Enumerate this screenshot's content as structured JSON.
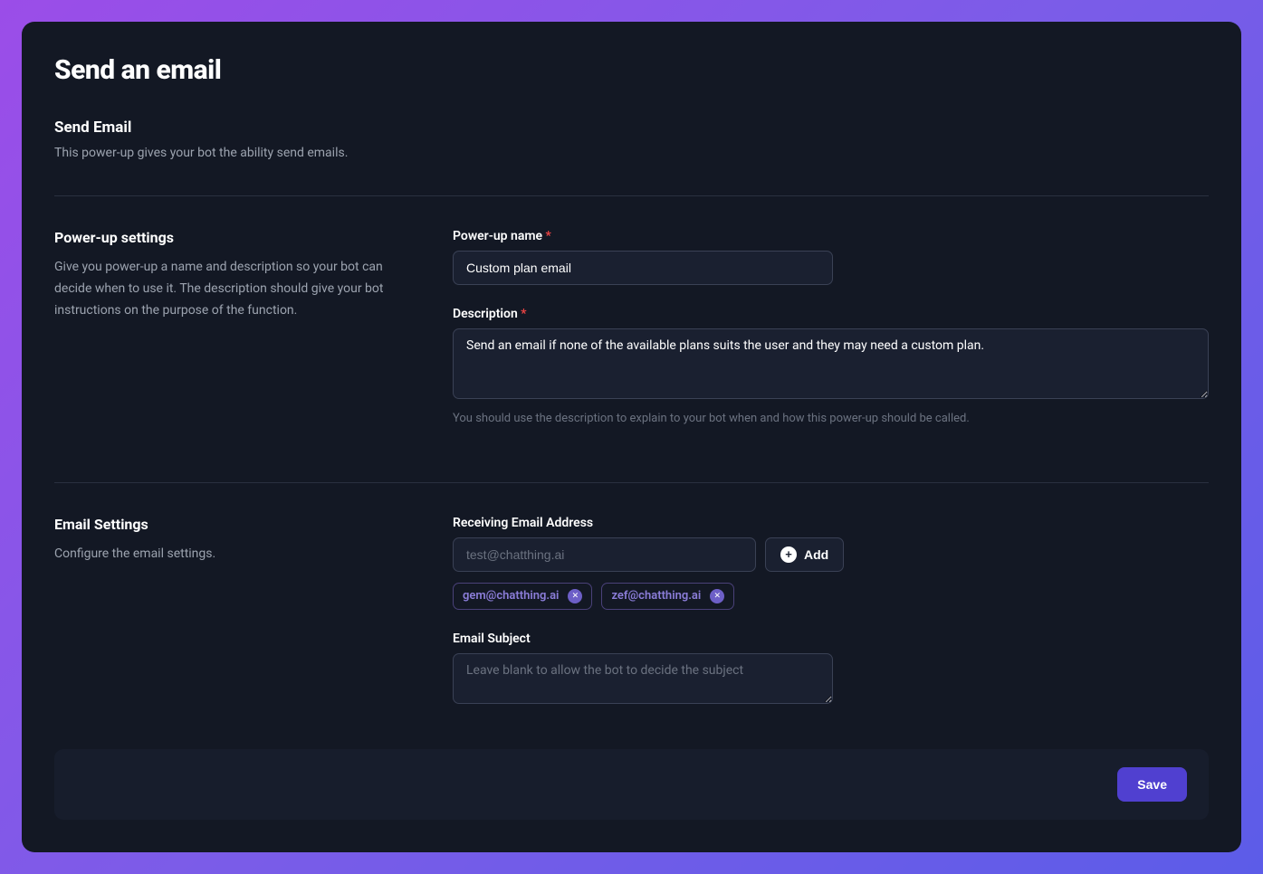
{
  "page": {
    "title": "Send an email"
  },
  "intro": {
    "title": "Send Email",
    "desc": "This power-up gives your bot the ability send emails."
  },
  "powerup_settings": {
    "title": "Power-up settings",
    "desc": "Give you power-up a name and description so your bot can decide when to use it. The description should give your bot instructions on the purpose of the function.",
    "name_label": "Power-up name",
    "name_value": "Custom plan email",
    "description_label": "Description",
    "description_value": "Send an email if none of the available plans suits the user and they may need a custom plan.",
    "description_help": "You should use the description to explain to your bot when and how this power-up should be called."
  },
  "email_settings": {
    "title": "Email Settings",
    "desc": "Configure the email settings.",
    "receiving_label": "Receiving Email Address",
    "receiving_placeholder": "test@chatthing.ai",
    "add_label": "Add",
    "chips": [
      {
        "email": "gem@chatthing.ai"
      },
      {
        "email": "zef@chatthing.ai"
      }
    ],
    "subject_label": "Email Subject",
    "subject_placeholder": "Leave blank to allow the bot to decide the subject"
  },
  "footer": {
    "save_label": "Save"
  }
}
